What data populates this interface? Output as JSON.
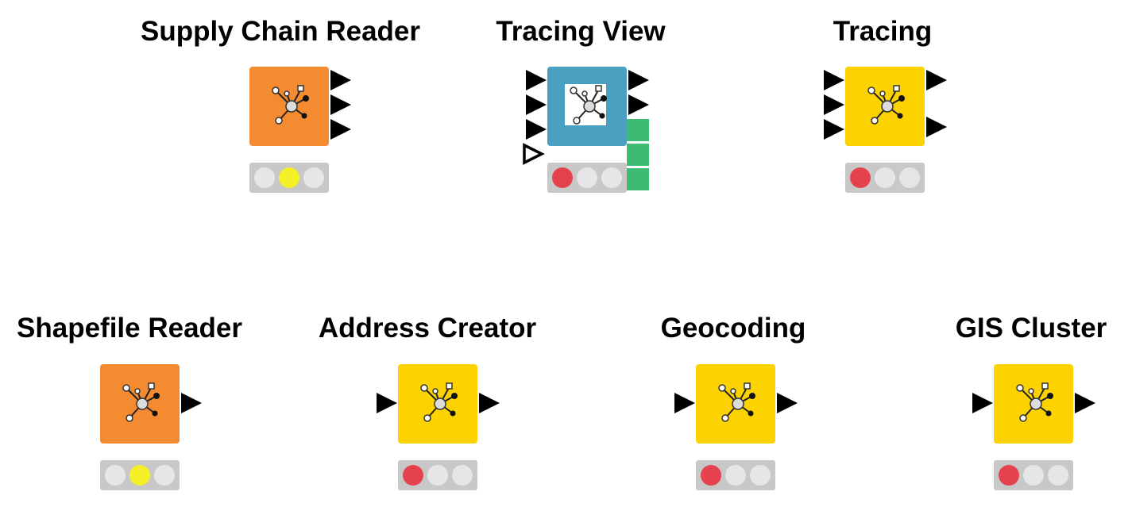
{
  "colors": {
    "source": "#f58b30",
    "manipulator": "#fcd200",
    "visualizer": "#4aa0c0",
    "status_bar": "#c8c8c8",
    "light_off": "#e6e6e6",
    "light_red": "#e5424d",
    "light_yellow": "#f4ef26",
    "view_port": "#3dba74"
  },
  "nodes": [
    {
      "id": "supply-chain-reader",
      "title": "Supply Chain Reader",
      "type": "source",
      "icon": "network-icon",
      "inputs": 0,
      "outputs": 3,
      "status": "configured"
    },
    {
      "id": "tracing-view",
      "title": "Tracing View",
      "type": "visualizer",
      "icon": "network-view-icon",
      "inputs": 3,
      "optional_inputs": 1,
      "outputs": 2,
      "view_ports": 3,
      "status": "not-configured"
    },
    {
      "id": "tracing",
      "title": "Tracing",
      "type": "manipulator",
      "icon": "network-icon",
      "inputs": 3,
      "outputs": 2,
      "status": "not-configured"
    },
    {
      "id": "shapefile-reader",
      "title": "Shapefile Reader",
      "type": "source",
      "icon": "network-icon",
      "inputs": 0,
      "outputs": 1,
      "status": "configured"
    },
    {
      "id": "address-creator",
      "title": "Address Creator",
      "type": "manipulator",
      "icon": "network-icon",
      "inputs": 1,
      "outputs": 1,
      "status": "not-configured"
    },
    {
      "id": "geocoding",
      "title": "Geocoding",
      "type": "manipulator",
      "icon": "network-icon",
      "inputs": 1,
      "outputs": 1,
      "status": "not-configured"
    },
    {
      "id": "gis-cluster",
      "title": "GIS Cluster",
      "type": "manipulator",
      "icon": "network-icon",
      "inputs": 1,
      "outputs": 1,
      "status": "not-configured"
    }
  ]
}
